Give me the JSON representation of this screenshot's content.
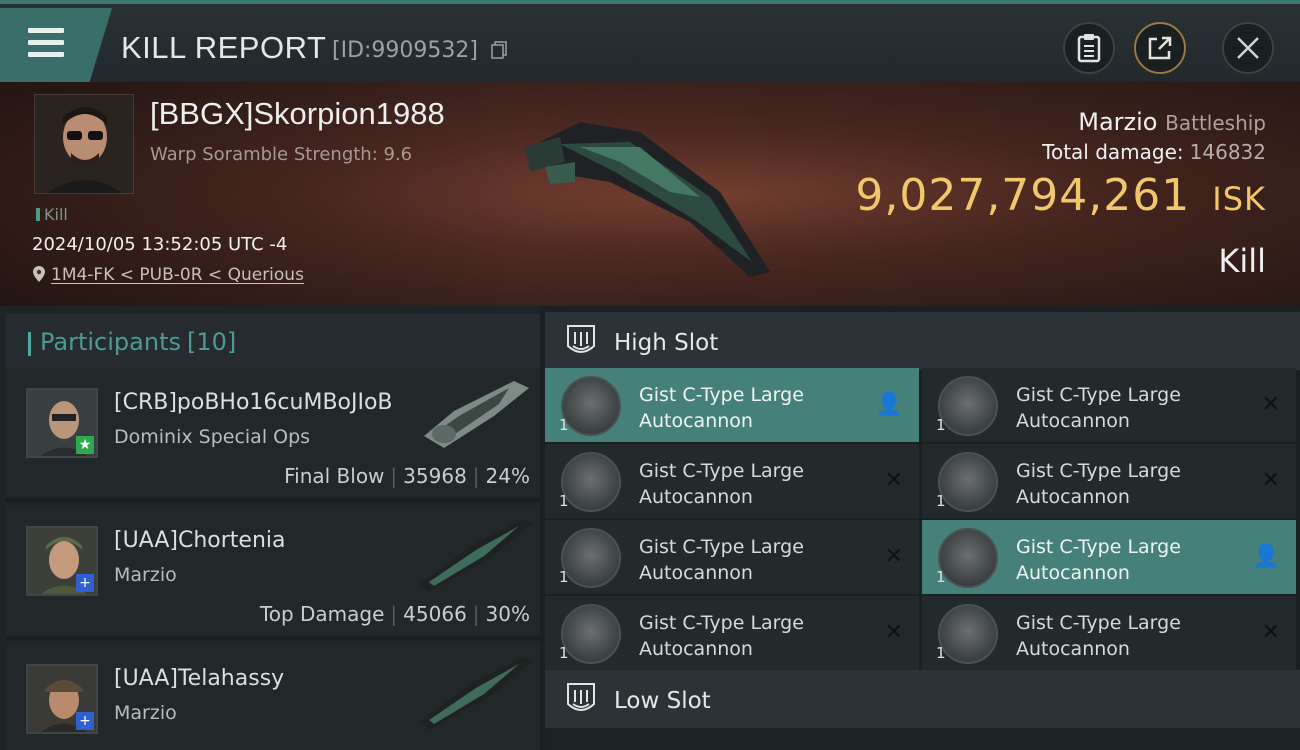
{
  "header": {
    "title": "KILL REPORT",
    "report_id": "[ID:9909532]"
  },
  "victim": {
    "name": "[BBGX]Skorpion1988",
    "warp_strength": "Warp Soramble Strength: 9.6",
    "kill_tag": "Kill",
    "datetime": "2024/10/05 13:52:05 UTC -4",
    "location": "1M4-FK < PUB-0R < Querious"
  },
  "summary": {
    "ship_name": "Marzio",
    "ship_class": "Battleship",
    "total_damage_label": "Total damage:",
    "total_damage": "146832",
    "isk_value": "9,027,794,261",
    "isk_unit": "ISK",
    "result": "Kill"
  },
  "participants": {
    "label": "Participants",
    "count": "[10]",
    "rows": [
      {
        "name": "[CRB]poBHo16cuMBoJIoB",
        "ship": "Dominix Special Ops",
        "stat_label": "Final Blow",
        "damage": "35968",
        "percent": "24%",
        "badge": "★",
        "badge_color": "#2fa84f"
      },
      {
        "name": "[UAA]Chortenia",
        "ship": "Marzio",
        "stat_label": "Top Damage",
        "damage": "45066",
        "percent": "30%",
        "badge": "+",
        "badge_color": "#2f5fd0"
      },
      {
        "name": "[UAA]Telahassy",
        "ship": "Marzio",
        "stat_label": "",
        "damage": "",
        "percent": "",
        "badge": "+",
        "badge_color": "#2f5fd0"
      }
    ]
  },
  "slots": {
    "high_label": "High Slot",
    "low_label": "Low Slot",
    "modules": [
      {
        "line1": "Gist C-Type Large",
        "line2": "Autocannon",
        "count": "1",
        "action": "👤"
      },
      {
        "line1": "Gist C-Type Large",
        "line2": "Autocannon",
        "count": "1",
        "action": "✕"
      },
      {
        "line1": "Gist C-Type Large",
        "line2": "Autocannon",
        "count": "1",
        "action": "✕"
      },
      {
        "line1": "Gist C-Type Large",
        "line2": "Autocannon",
        "count": "1",
        "action": "✕"
      },
      {
        "line1": "Gist C-Type Large",
        "line2": "Autocannon",
        "count": "1",
        "action": "✕"
      },
      {
        "line1": "Gist C-Type Large",
        "line2": "Autocannon",
        "count": "1",
        "action": "👤"
      },
      {
        "line1": "Gist C-Type Large",
        "line2": "Autocannon",
        "count": "1",
        "action": "✕"
      },
      {
        "line1": "Gist C-Type Large",
        "line2": "Autocannon",
        "count": "1",
        "action": "✕"
      }
    ]
  },
  "colors": {
    "accent": "#46807a",
    "isk_gold": "#f0c76b"
  }
}
